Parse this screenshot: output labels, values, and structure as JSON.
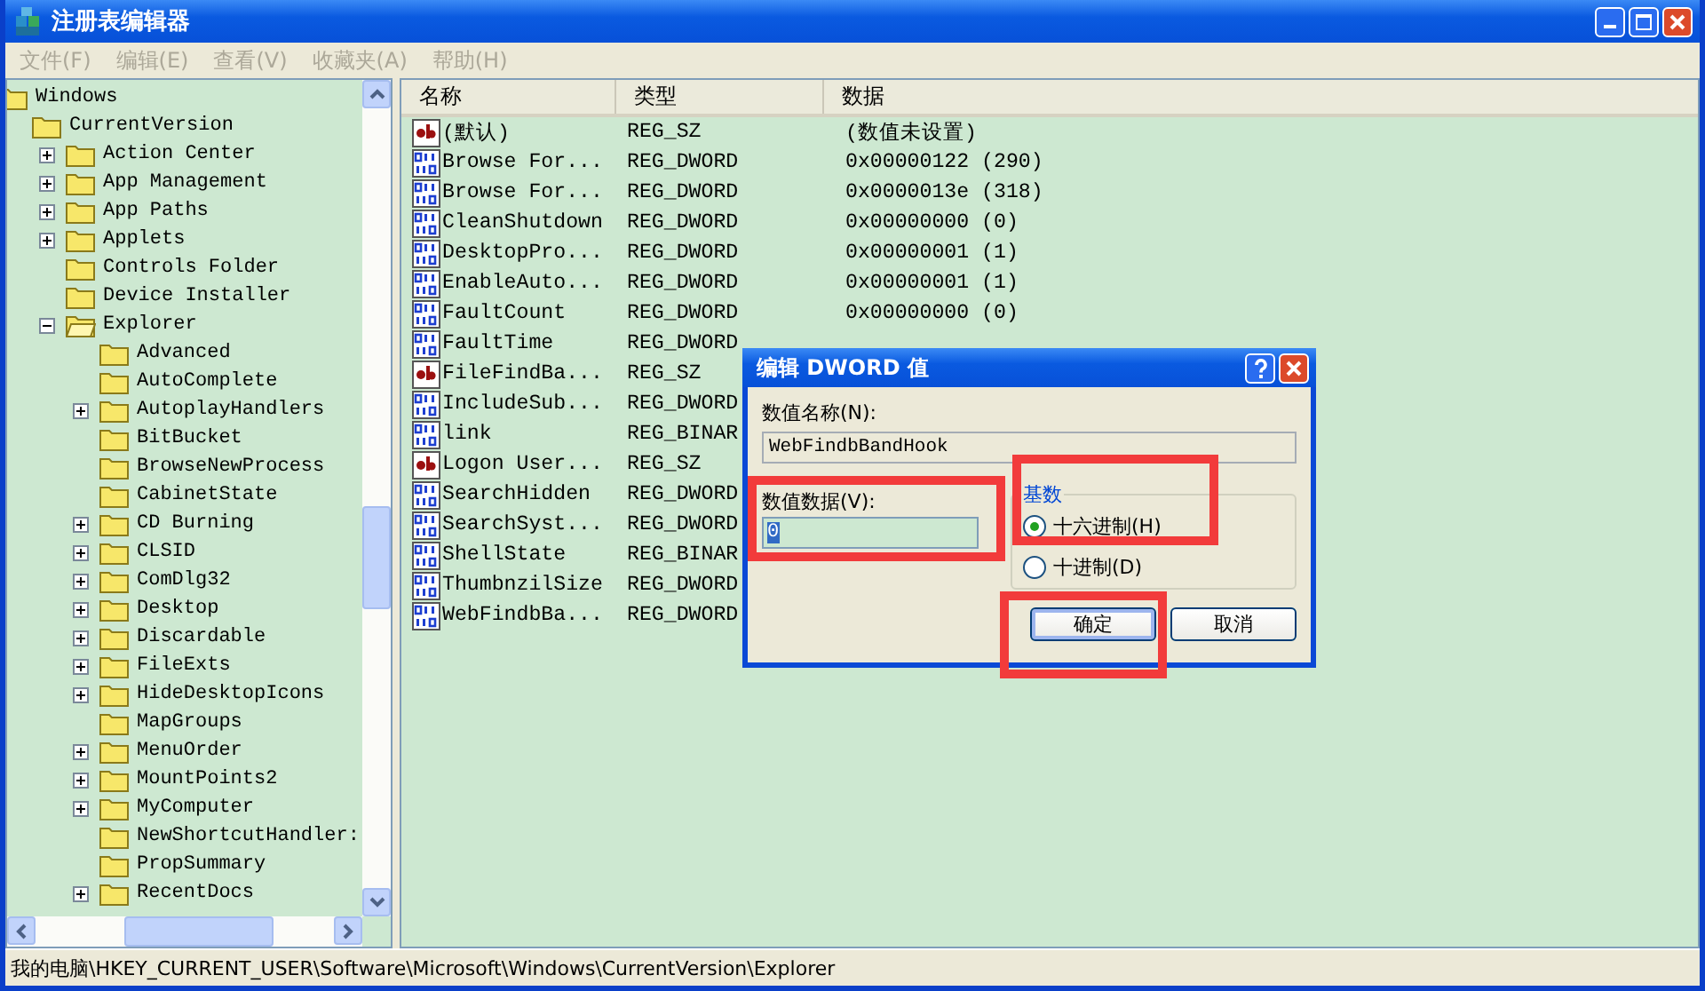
{
  "window": {
    "title": "注册表编辑器"
  },
  "menu": [
    {
      "label": "文件(F)",
      "disabled": true
    },
    {
      "label": "编辑(E)",
      "disabled": true
    },
    {
      "label": "查看(V)",
      "disabled": true
    },
    {
      "label": "收藏夹(A)",
      "disabled": true
    },
    {
      "label": "帮助(H)",
      "disabled": true
    }
  ],
  "tree": [
    {
      "label": "Windows",
      "expandable": false,
      "children": [
        {
          "label": "CurrentVersion",
          "expandable": false,
          "children": [
            {
              "label": "Action Center",
              "expandable": true,
              "expanded": false
            },
            {
              "label": "App Management",
              "expandable": true,
              "expanded": false
            },
            {
              "label": "App Paths",
              "expandable": true,
              "expanded": false
            },
            {
              "label": "Applets",
              "expandable": true,
              "expanded": false
            },
            {
              "label": "Controls Folder",
              "expandable": false
            },
            {
              "label": "Device Installer",
              "expandable": false
            },
            {
              "label": "Explorer",
              "expandable": true,
              "expanded": true,
              "children": [
                {
                  "label": "Advanced",
                  "expandable": false
                },
                {
                  "label": "AutoComplete",
                  "expandable": false
                },
                {
                  "label": "AutoplayHandlers",
                  "expandable": true,
                  "expanded": false
                },
                {
                  "label": "BitBucket",
                  "expandable": false
                },
                {
                  "label": "BrowseNewProcess",
                  "expandable": false
                },
                {
                  "label": "CabinetState",
                  "expandable": false
                },
                {
                  "label": "CD Burning",
                  "expandable": true,
                  "expanded": false
                },
                {
                  "label": "CLSID",
                  "expandable": true,
                  "expanded": false
                },
                {
                  "label": "ComDlg32",
                  "expandable": true,
                  "expanded": false
                },
                {
                  "label": "Desktop",
                  "expandable": true,
                  "expanded": false
                },
                {
                  "label": "Discardable",
                  "expandable": true,
                  "expanded": false
                },
                {
                  "label": "FileExts",
                  "expandable": true,
                  "expanded": false
                },
                {
                  "label": "HideDesktopIcons",
                  "expandable": true,
                  "expanded": false
                },
                {
                  "label": "MapGroups",
                  "expandable": false
                },
                {
                  "label": "MenuOrder",
                  "expandable": true,
                  "expanded": false
                },
                {
                  "label": "MountPoints2",
                  "expandable": true,
                  "expanded": false
                },
                {
                  "label": "MyComputer",
                  "expandable": true,
                  "expanded": false
                },
                {
                  "label": "NewShortcutHandler:",
                  "expandable": false
                },
                {
                  "label": "PropSummary",
                  "expandable": false
                },
                {
                  "label": "RecentDocs",
                  "expandable": true,
                  "expanded": false
                }
              ]
            }
          ]
        }
      ]
    }
  ],
  "list": {
    "columns": [
      "名称",
      "类型",
      "数据"
    ],
    "rows": [
      {
        "kind": "string",
        "name": "(默认)",
        "type": "REG_SZ",
        "data": "(数值未设置)"
      },
      {
        "kind": "binary",
        "name": "Browse For...",
        "type": "REG_DWORD",
        "data": "0x00000122 (290)"
      },
      {
        "kind": "binary",
        "name": "Browse For...",
        "type": "REG_DWORD",
        "data": "0x0000013e (318)"
      },
      {
        "kind": "binary",
        "name": "CleanShutdown",
        "type": "REG_DWORD",
        "data": "0x00000000 (0)"
      },
      {
        "kind": "binary",
        "name": "DesktopPro...",
        "type": "REG_DWORD",
        "data": "0x00000001 (1)"
      },
      {
        "kind": "binary",
        "name": "EnableAuto...",
        "type": "REG_DWORD",
        "data": "0x00000001 (1)"
      },
      {
        "kind": "binary",
        "name": "FaultCount",
        "type": "REG_DWORD",
        "data": "0x00000000 (0)"
      },
      {
        "kind": "binary",
        "name": "FaultTime",
        "type": "REG_DWORD"
      },
      {
        "kind": "string",
        "name": "FileFindBa...",
        "type": "REG_SZ"
      },
      {
        "kind": "binary",
        "name": "IncludeSub...",
        "type": "REG_DWORD"
      },
      {
        "kind": "binary",
        "name": "link",
        "type": "REG_BINAR"
      },
      {
        "kind": "string",
        "name": "Logon User...",
        "type": "REG_SZ"
      },
      {
        "kind": "binary",
        "name": "SearchHidden",
        "type": "REG_DWORD"
      },
      {
        "kind": "binary",
        "name": "SearchSyst...",
        "type": "REG_DWORD"
      },
      {
        "kind": "binary",
        "name": "ShellState",
        "type": "REG_BINAR"
      },
      {
        "kind": "binary",
        "name": "ThumbnzilSize",
        "type": "REG_DWORD"
      },
      {
        "kind": "binary",
        "name": "WebFindbBa...",
        "type": "REG_DWORD"
      }
    ]
  },
  "dialog": {
    "title": "编辑 DWORD 值",
    "name_label": "数值名称(N):",
    "name_value": "WebFindbBandHook",
    "data_label": "数值数据(V):",
    "data_value": "0",
    "radix_label": "基数",
    "radix_options": [
      {
        "label": "十六进制(H)",
        "selected": true
      },
      {
        "label": "十进制(D)",
        "selected": false
      }
    ],
    "buttons": [
      {
        "label": "确定",
        "default": true
      },
      {
        "label": "取消",
        "default": false
      }
    ]
  },
  "highlights": [
    {
      "kind": "data"
    },
    {
      "kind": "radix"
    },
    {
      "kind": "ok"
    }
  ],
  "status_bar": "我的电脑\\HKEY_CURRENT_USER\\Software\\Microsoft\\Windows\\CurrentVersion\\Explorer"
}
